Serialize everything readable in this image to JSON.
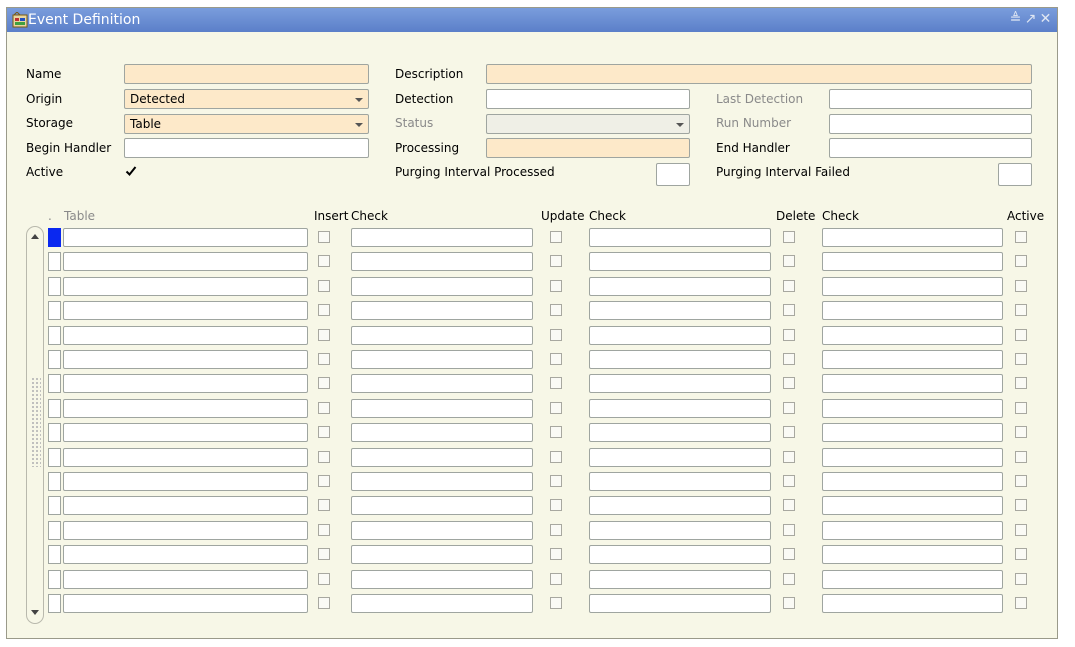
{
  "window": {
    "title": "Event Definition"
  },
  "form": {
    "name_label": "Name",
    "origin_label": "Origin",
    "origin_value": "Detected",
    "storage_label": "Storage",
    "storage_value": "Table",
    "begin_handler_label": "Begin Handler",
    "active_label": "Active",
    "active_checked": true,
    "description_label": "Description",
    "detection_label": "Detection",
    "status_label": "Status",
    "processing_label": "Processing",
    "purging_processed_label": "Purging Interval Processed",
    "last_detection_label": "Last Detection",
    "run_number_label": "Run Number",
    "end_handler_label": "End Handler",
    "purging_failed_label": "Purging Interval Failed"
  },
  "grid": {
    "columns": {
      "table": "Table",
      "insert": "Insert",
      "insert_check": "Check",
      "update": "Update",
      "update_check": "Check",
      "delete": "Delete",
      "delete_check": "Check",
      "active": "Active"
    },
    "row_count": 16,
    "current_row": 1
  },
  "icons": {
    "app": "form-app-icon",
    "minimize": "minimize-icon",
    "maximize": "maximize-icon",
    "close": "close-icon",
    "check": "checkmark-icon",
    "scroll_up": "scroll-up-icon",
    "scroll_down": "scroll-down-icon"
  },
  "colors": {
    "titlebar": "#5b7fc9",
    "required_field": "#fde9c9",
    "current_record": "#0a28f0",
    "background": "#f7f7e7"
  }
}
